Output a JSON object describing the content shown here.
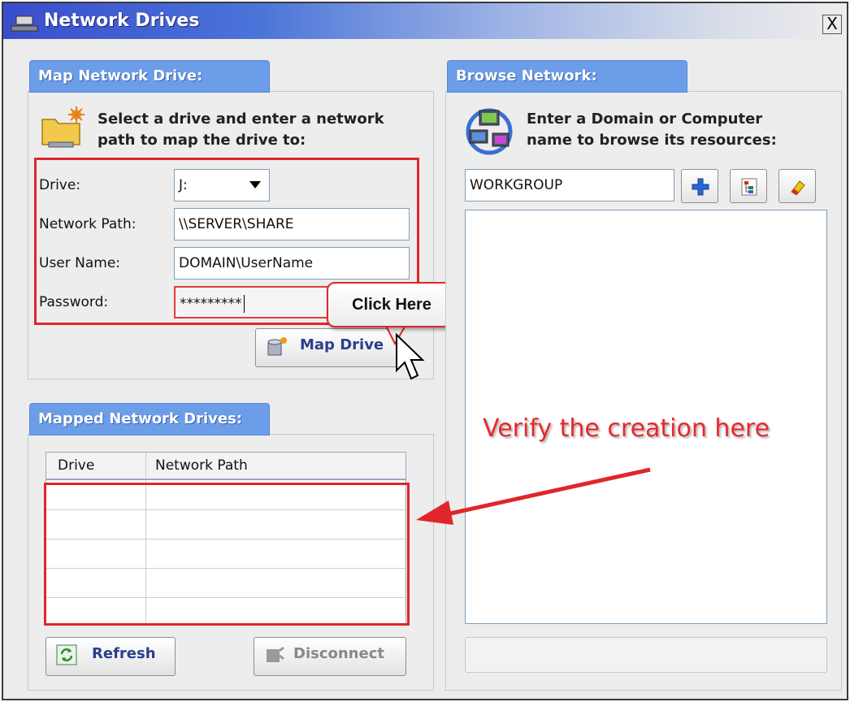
{
  "window": {
    "title": "Network Drives",
    "close_glyph": "X"
  },
  "map_drive": {
    "tab_label": "Map Network Drive:",
    "heading_line1": "Select a drive and enter a network",
    "heading_line2": "path to map the drive to:",
    "icon": "folder-network-icon",
    "drive_label": "Drive:",
    "drive_value": "J:",
    "path_label": "Network Path:",
    "path_value": "\\\\SERVER\\SHARE",
    "user_label": "User Name:",
    "user_value": "DOMAIN\\UserName",
    "password_label": "Password:",
    "password_value": "*********",
    "map_button_label": "Map Drive"
  },
  "callout": {
    "text": "Click Here"
  },
  "mapped": {
    "tab_label": "Mapped Network Drives:",
    "columns": [
      "Drive",
      "Network Path"
    ],
    "rows": [],
    "refresh_label": "Refresh",
    "disconnect_label": "Disconnect"
  },
  "browse": {
    "tab_label": "Browse Network:",
    "heading_line1": "Enter a Domain or Computer",
    "heading_line2": "name to browse its resources:",
    "icon": "network-computers-icon",
    "domain_value": "WORKGROUP",
    "buttons": [
      "add-icon",
      "browse-tree-icon",
      "clear-eraser-icon"
    ]
  },
  "annotation": {
    "text": "Verify the creation here"
  },
  "colors": {
    "accent_red": "#e0262a",
    "tab_blue": "#6c9de8",
    "title_blue": "#3a4dcc"
  }
}
